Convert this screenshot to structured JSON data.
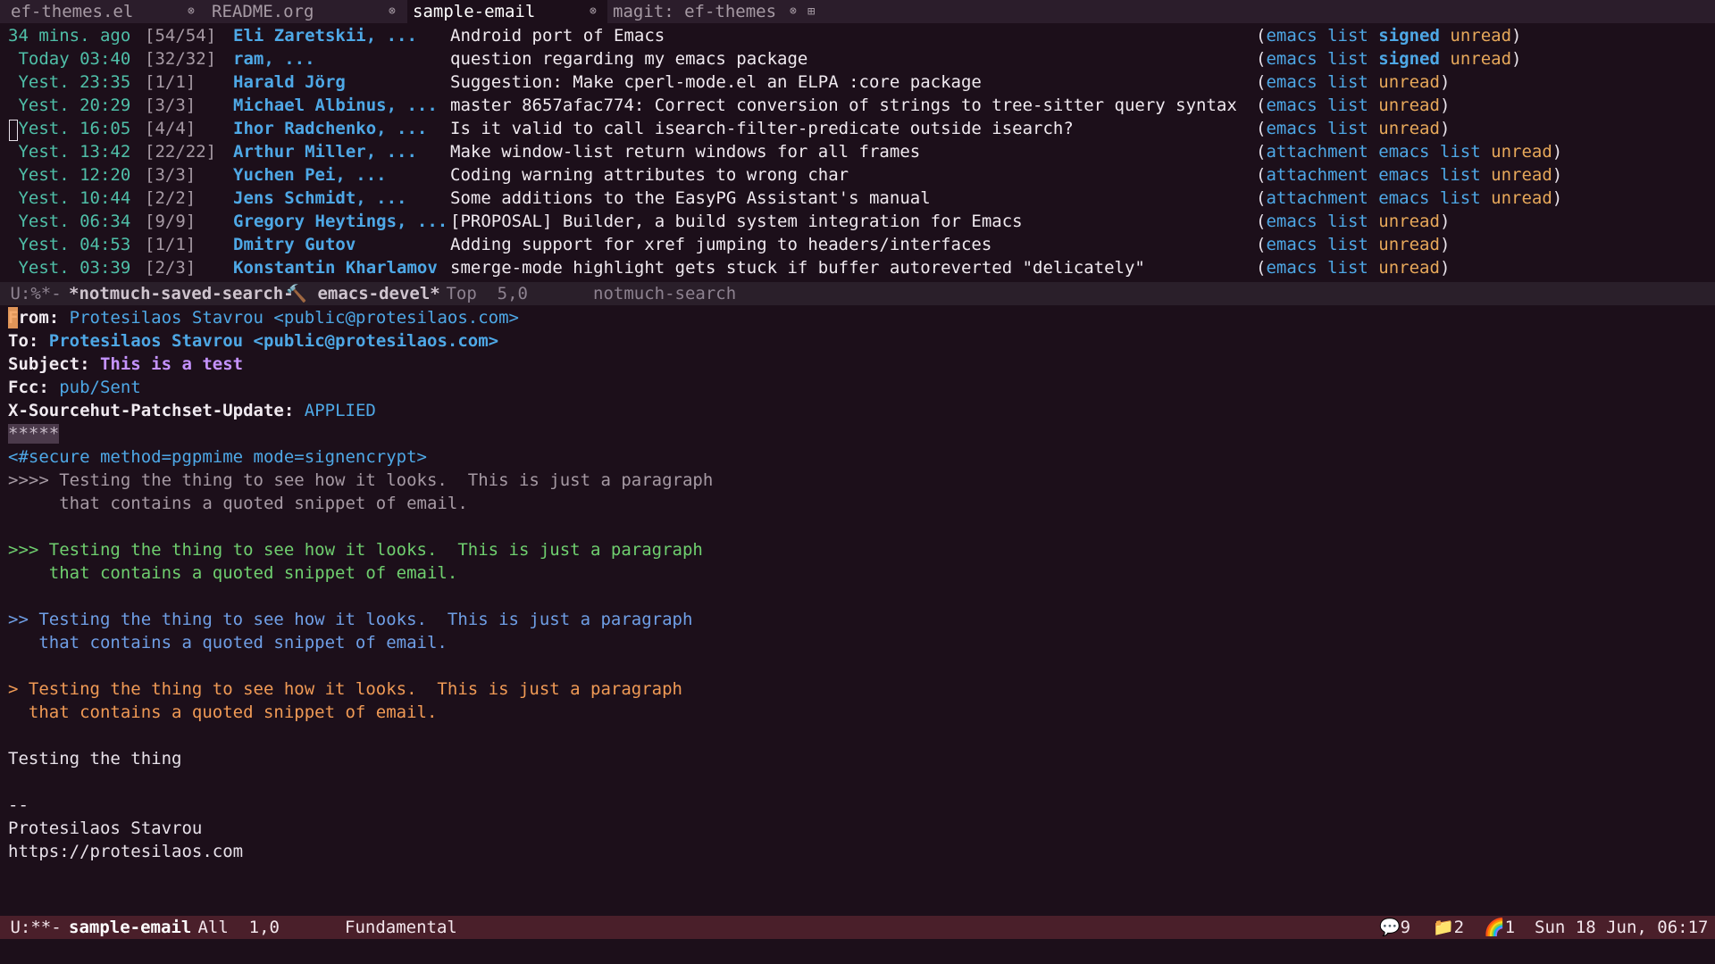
{
  "tabs": [
    {
      "label": "ef-themes.el",
      "close": "⊗"
    },
    {
      "label": "README.org",
      "close": "⊗"
    },
    {
      "label": "sample-email",
      "close": "⊗"
    },
    {
      "label": "magit: ef-themes",
      "close": "⊗"
    }
  ],
  "new_tab": "⊞",
  "search_results": [
    {
      "date": "34 mins. ago",
      "count": "[54/54]",
      "authors": "Eli Zaretskii, ...",
      "subject": "Android port of Emacs",
      "tags_text": "emacs list",
      "signed": "signed",
      "extra": "unread"
    },
    {
      "date": " Today 03:40",
      "count": "[32/32]",
      "authors": "ram, ...",
      "subject": "question regarding my emacs package",
      "tags_text": "emacs list",
      "signed": "signed",
      "extra": "unread"
    },
    {
      "date": " Yest. 23:35",
      "count": "[1/1]",
      "authors": "Harald Jörg",
      "subject": "Suggestion: Make cperl-mode.el an ELPA :core package",
      "tags_text": "emacs list",
      "signed": "",
      "extra": "unread"
    },
    {
      "date": " Yest. 20:29",
      "count": "[3/3]",
      "authors": "Michael Albinus, ...",
      "subject": "master 8657afac774: Correct conversion of strings to tree-sitter query syntax",
      "tags_text": "emacs list",
      "signed": "",
      "extra": "unread"
    },
    {
      "date": " Yest. 16:05",
      "count": "[4/4]",
      "authors": "Ihor Radchenko, ...",
      "subject": "Is it valid to call isearch-filter-predicate outside isearch?",
      "tags_text": "emacs list",
      "signed": "",
      "extra": "unread"
    },
    {
      "date": " Yest. 13:42",
      "count": "[22/22]",
      "authors": "Arthur Miller, ...",
      "subject": "Make window-list return windows for all frames",
      "tags_text": "attachment emacs list",
      "signed": "",
      "extra": "unread"
    },
    {
      "date": " Yest. 12:20",
      "count": "[3/3]",
      "authors": "Yuchen Pei, ...",
      "subject": "Coding warning attributes to wrong char",
      "tags_text": "attachment emacs list",
      "signed": "",
      "extra": "unread"
    },
    {
      "date": " Yest. 10:44",
      "count": "[2/2]",
      "authors": "Jens Schmidt, ...",
      "subject": "Some additions to the EasyPG Assistant's manual",
      "tags_text": "attachment emacs list",
      "signed": "",
      "extra": "unread"
    },
    {
      "date": " Yest. 06:34",
      "count": "[9/9]",
      "authors": "Gregory Heytings, ...",
      "subject": "[PROPOSAL] Builder, a build system integration for Emacs",
      "tags_text": "emacs list",
      "signed": "",
      "extra": "unread"
    },
    {
      "date": " Yest. 04:53",
      "count": "[1/1]",
      "authors": "Dmitry Gutov",
      "subject": "Adding support for xref jumping to headers/interfaces",
      "tags_text": "emacs list",
      "signed": "",
      "extra": "unread"
    },
    {
      "date": " Yest. 03:39",
      "count": "[2/3]",
      "authors": "Konstantin Kharlamov",
      "subject": "smerge-mode highlight gets stuck if buffer autoreverted \"delicately\"",
      "tags_text": "emacs list",
      "signed": "",
      "extra": "unread"
    }
  ],
  "modeline_search": {
    "status": " U:%*- ",
    "buffer": "*notmuch-saved-search-",
    "hammer": "🔨",
    "buffer2": " emacs-devel*",
    "position": " Top  5,0",
    "mode": "notmuch-search"
  },
  "email": {
    "from_key": "From:",
    "from_value": "Protesilaos Stavrou <public@protesilaos.com>",
    "to_key": "To:",
    "to_value": "Protesilaos Stavrou <public@protesilaos.com>",
    "subject_key": "Subject:",
    "subject_value": "This is a test",
    "fcc_key": "Fcc:",
    "fcc_value": "pub/Sent",
    "sourcehut_key": "X-Sourcehut-Patchset-Update:",
    "sourcehut_value": "APPLIED",
    "separator": "*****",
    "mml_tag": "<#secure method=pgpmime mode=signencrypt>",
    "quote4_line1": ">>>> Testing the thing to see how it looks.  This is just a paragraph",
    "quote4_line2": "     that contains a quoted snippet of email.",
    "quote3_line1": ">>> Testing the thing to see how it looks.  This is just a paragraph",
    "quote3_line2": "    that contains a quoted snippet of email.",
    "quote2_line1": ">> Testing the thing to see how it looks.  This is just a paragraph",
    "quote2_line2": "   that contains a quoted snippet of email.",
    "quote1_line1": "> Testing the thing to see how it looks.  This is just a paragraph",
    "quote1_line2": "  that contains a quoted snippet of email.",
    "body_line": "Testing the thing",
    "sig_sep": "--",
    "sig_name": "Protesilaos Stavrou",
    "sig_url": "https://protesilaos.com"
  },
  "modeline_email": {
    "status": " U:**- ",
    "buffer": "sample-email",
    "position": " All  1,0",
    "mode": "Fundamental",
    "notif_count": "9",
    "folder_count": "2",
    "rainbow_count": "1",
    "datetime": "Sun 18 Jun, 06:17"
  }
}
